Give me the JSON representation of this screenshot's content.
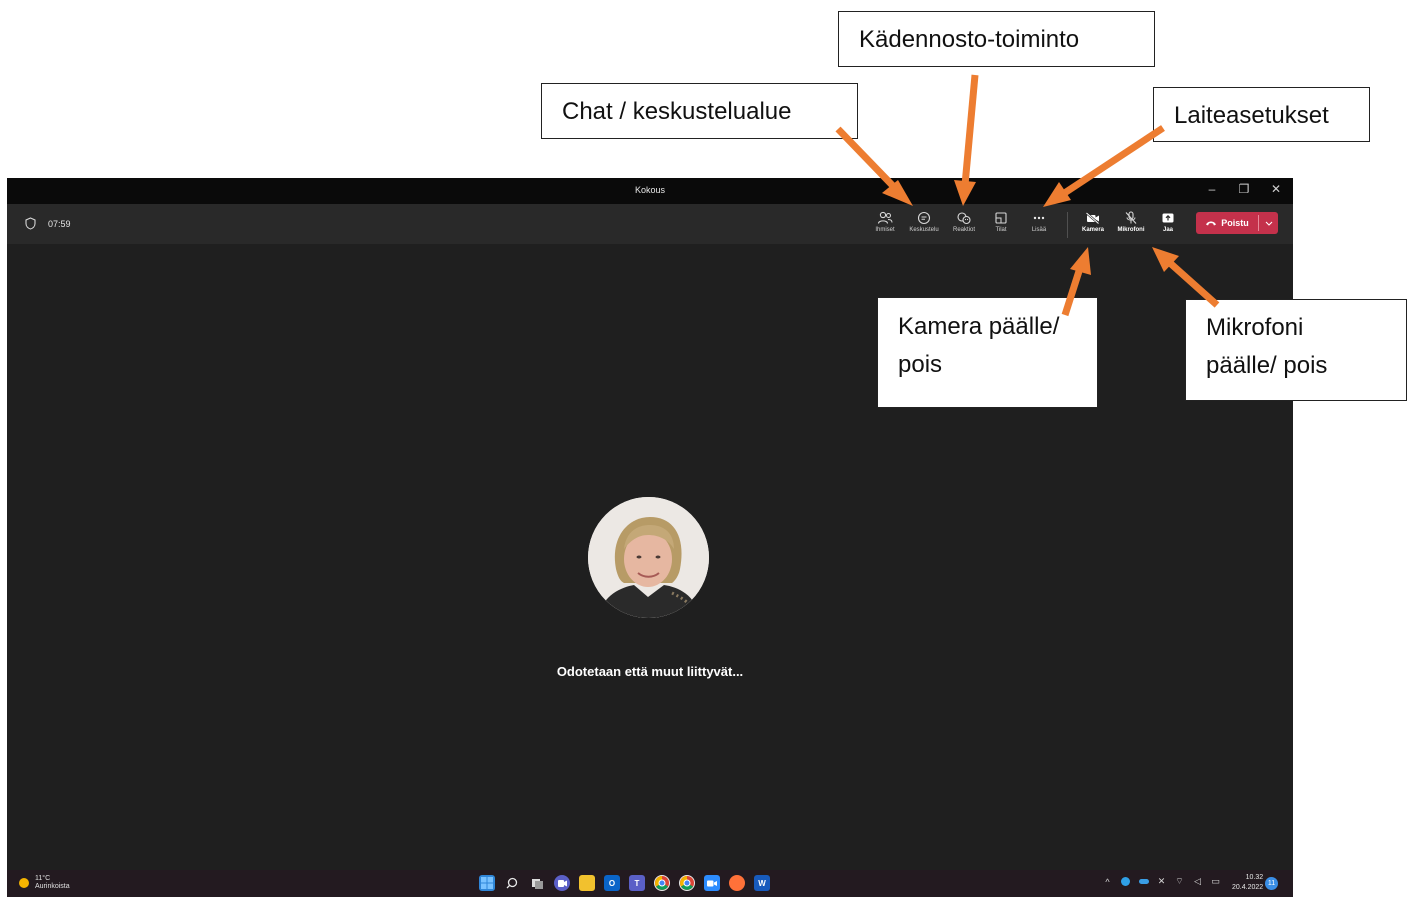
{
  "window": {
    "title": "Kokous",
    "controls": [
      "–",
      "❐",
      "✕"
    ]
  },
  "toolbar": {
    "timer": "07:59",
    "buttons": [
      {
        "id": "people",
        "label": "Ihmiset",
        "icon": "people-icon"
      },
      {
        "id": "chat",
        "label": "Keskustelu",
        "icon": "chat-icon"
      },
      {
        "id": "reactions",
        "label": "Reaktiot",
        "icon": "reaction-icon"
      },
      {
        "id": "rooms",
        "label": "Tilat",
        "icon": "rooms-icon"
      },
      {
        "id": "more",
        "label": "Lisää",
        "icon": "more-icon"
      },
      {
        "id": "camera",
        "label": "Kamera",
        "icon": "camera-off-icon"
      },
      {
        "id": "mic",
        "label": "Mikrofoni",
        "icon": "mic-off-icon"
      },
      {
        "id": "share",
        "label": "Jaa",
        "icon": "share-icon"
      }
    ],
    "leave_label": "Poistu"
  },
  "stage": {
    "waiting_text": "Odotetaan että muut liittyvät..."
  },
  "taskbar": {
    "temperature": "11°C",
    "weather": "Aurinkoista",
    "time": "10.32",
    "date": "20.4.2022",
    "notifications": "11",
    "apps": [
      "start",
      "search",
      "task-view",
      "teams-chat",
      "file-explorer",
      "outlook",
      "teams",
      "chrome",
      "chrome-profile",
      "zoom",
      "firefox",
      "word"
    ]
  },
  "annotations": {
    "chat": "Chat / keskustelualue",
    "raise_hand": "Kädennosto-toiminto",
    "device_settings": "Laiteasetukset",
    "camera_1": "Kamera päälle/",
    "camera_2": "pois",
    "mic_1": "Mikrofoni",
    "mic_2": "päälle/ pois"
  },
  "colors": {
    "window_bg": "#1f1f1f",
    "toolbar_bg": "#292929",
    "leave_red": "#c4314b",
    "arrow_orange": "#ed7d31"
  }
}
